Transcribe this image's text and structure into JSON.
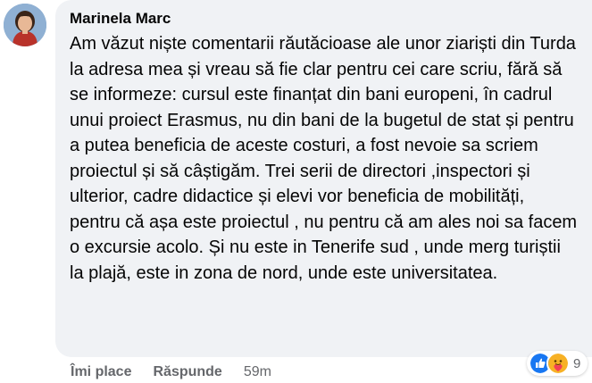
{
  "comment": {
    "author": "Marinela Marc",
    "text": "Am văzut niște comentarii răutăcioase ale unor ziariști din Turda la adresa mea și vreau să fie clar pentru cei care scriu, fără să se informeze: cursul este finanțat din bani europeni, în cadrul unui proiect Erasmus, nu din bani de la bugetul de stat și pentru a putea beneficia de aceste costuri, a fost nevoie sa scriem proiectul și să câștigăm. Trei serii de directori ,inspectori și ulterior, cadre didactice și elevi vor beneficia de mobilități, pentru că așa este proiectul , nu pentru că am ales noi sa facem o excursie acolo. Și nu este in Tenerife sud , unde merg turiștii la plajă, este in zona de nord, unde este universitatea."
  },
  "actions": {
    "like_label": "Îmi place",
    "reply_label": "Răspunde",
    "timestamp": "59m"
  },
  "reactions": {
    "icons": [
      "like-icon",
      "care-icon"
    ],
    "count": "9",
    "colors": {
      "like": "#1877f2",
      "care": "#f7b125"
    }
  },
  "colors": {
    "bubble_bg": "#f0f2f5",
    "text": "#050505",
    "meta": "#65676b"
  }
}
